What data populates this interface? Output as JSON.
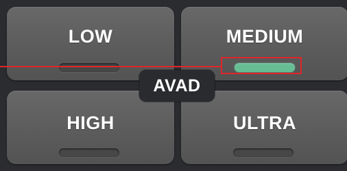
{
  "mode_buttons": [
    {
      "label": "LOW",
      "active": false
    },
    {
      "label": "MEDIUM",
      "active": true
    },
    {
      "label": "HIGH",
      "active": false
    },
    {
      "label": "ULTRA",
      "active": false
    }
  ],
  "center_badge": {
    "label": "AVAD"
  },
  "colors": {
    "panel_background": "#2b2c30",
    "button_face": "#5e5e5e",
    "indicator_off": "#474747",
    "indicator_on": "#66bd94",
    "annotation_red": "#e0262b",
    "label_text": "#ffffff"
  }
}
